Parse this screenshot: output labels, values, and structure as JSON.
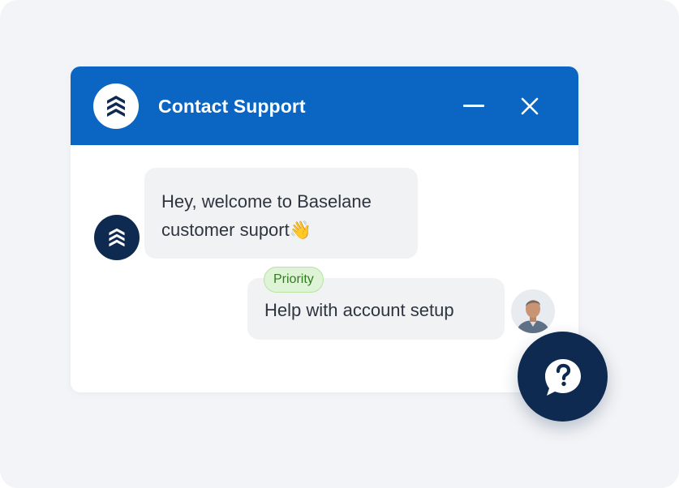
{
  "header": {
    "title": "Contact Support",
    "logo_icon": "baselane-chevrons-icon",
    "minimize_icon": "minimize-icon",
    "close_icon": "close-icon"
  },
  "messages": [
    {
      "sender": "bot",
      "avatar_icon": "baselane-chevrons-icon",
      "line1": "Hey, welcome to Baselane",
      "line2": "customer suport👋"
    },
    {
      "sender": "user",
      "badge": "Priority",
      "text": "Help with account setup"
    }
  ],
  "help_button": {
    "icon": "question-chat-icon"
  },
  "colors": {
    "header_bg": "#0a66c2",
    "navy": "#0e2a50",
    "bubble_bg": "#f1f2f4",
    "badge_bg": "#dff3d6",
    "badge_text": "#2f7d1f",
    "page_bg": "#f3f4f7"
  }
}
